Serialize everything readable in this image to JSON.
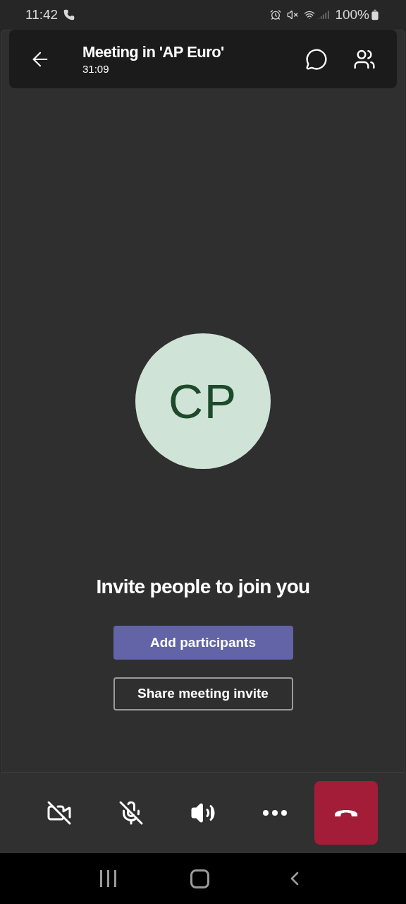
{
  "status_bar": {
    "time": "11:42",
    "battery": "100%"
  },
  "header": {
    "title": "Meeting in 'AP Euro'",
    "duration": "31:09"
  },
  "avatar": {
    "initials": "CP"
  },
  "invite": {
    "heading": "Invite people to join you",
    "primary_button": "Add participants",
    "secondary_button": "Share meeting invite"
  },
  "controls": {
    "camera_on": false,
    "mic_on": false
  }
}
